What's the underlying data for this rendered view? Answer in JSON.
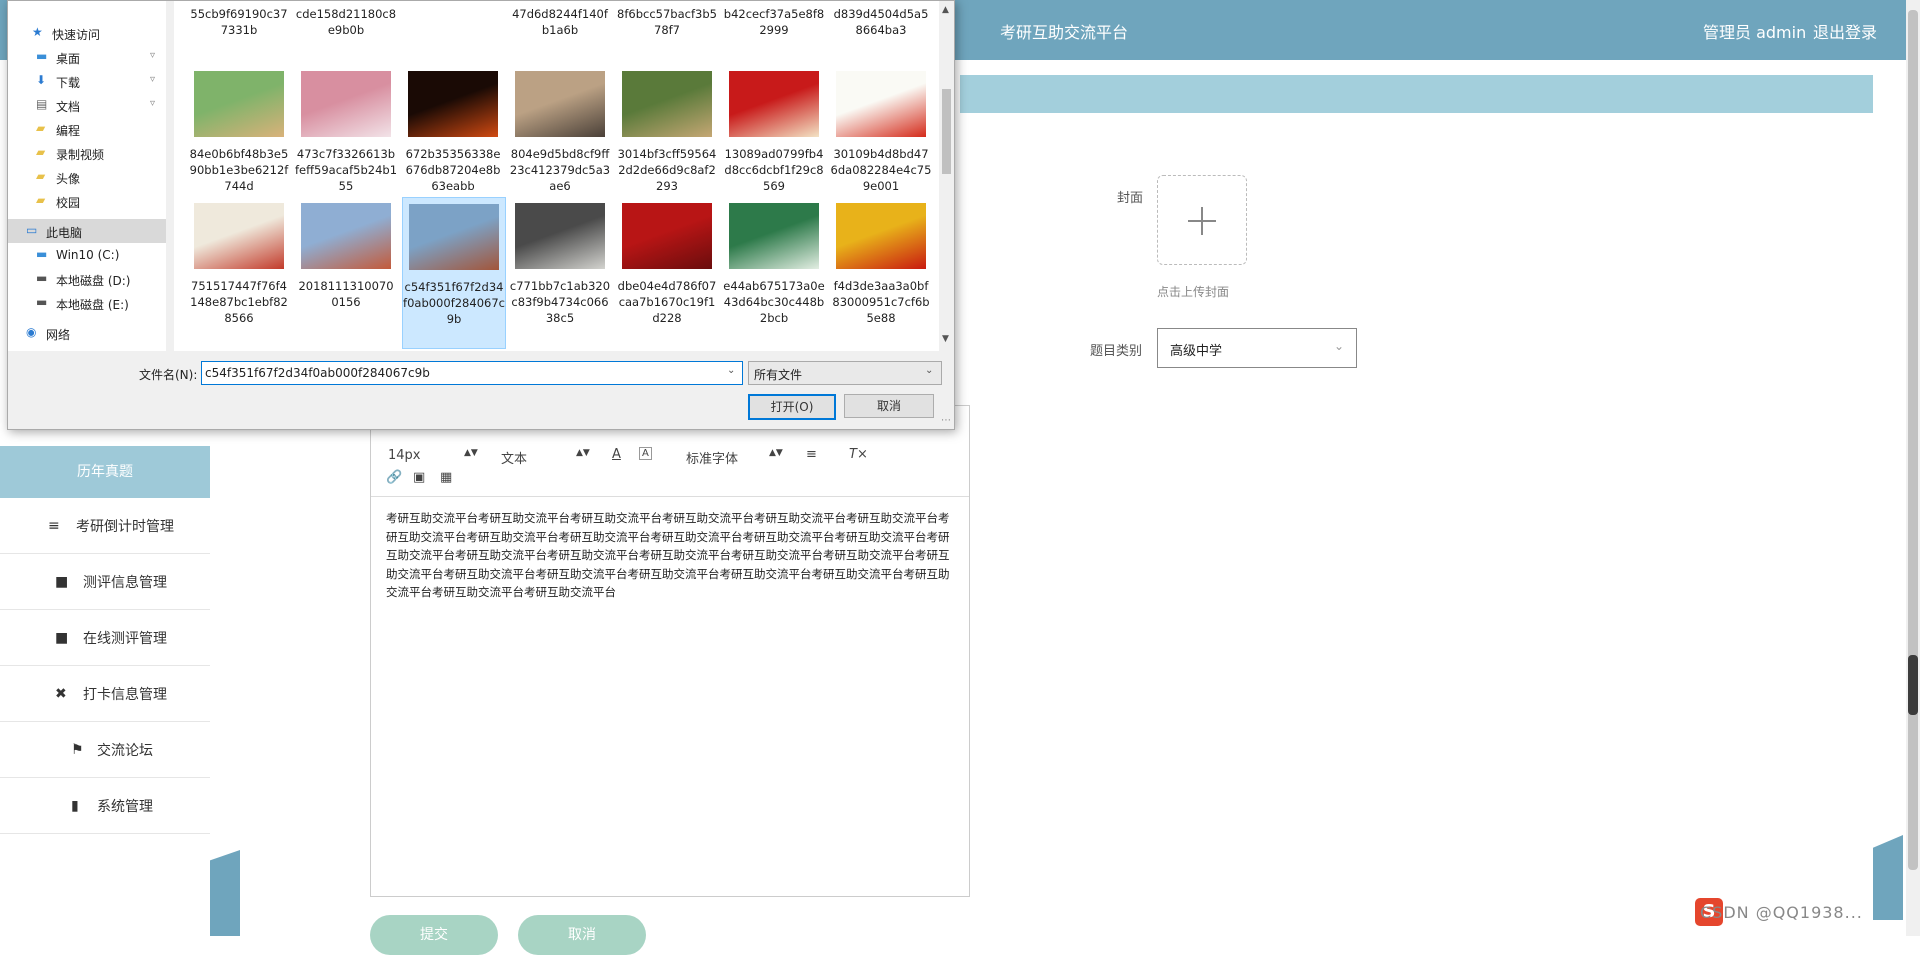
{
  "header": {
    "site_title": "考研互助交流平台",
    "admin_info": "管理员 admin",
    "logout": "退出登录"
  },
  "sidebar": {
    "active": "历年真题",
    "items": [
      {
        "label": "考研倒计时管理",
        "icon": "≡"
      },
      {
        "label": "测评信息管理",
        "icon": "■"
      },
      {
        "label": "在线测评管理",
        "icon": "■"
      },
      {
        "label": "打卡信息管理",
        "icon": "✖"
      },
      {
        "label": "交流论坛",
        "icon": "⚑"
      },
      {
        "label": "系统管理",
        "icon": "▮"
      }
    ]
  },
  "form": {
    "cover_label": "封面",
    "upload_tip": "点击上传封面",
    "category_label": "题目类别",
    "category_value": "高级中学"
  },
  "editor": {
    "font_size": "14px",
    "text_type": "文本",
    "font_family": "标准字体",
    "content": "考研互助交流平台考研互助交流平台考研互助交流平台考研互助交流平台考研互助交流平台考研互助交流平台考研互助交流平台考研互助交流平台考研互助交流平台考研互助交流平台考研互助交流平台考研互助交流平台考研互助交流平台考研互助交流平台考研互助交流平台考研互助交流平台考研互助交流平台考研互助交流平台考研互助交流平台考研互助交流平台考研互助交流平台考研互助交流平台考研互助交流平台考研互助交流平台考研互助交流平台考研互助交流平台考研互助交流平台"
  },
  "buttons": {
    "submit": "提交",
    "cancel": "取消"
  },
  "watermark": "CSDN @QQ1938...",
  "dialog": {
    "nav": [
      {
        "label": "快速访问",
        "icon": "★",
        "color": "#2b7bd1",
        "pinned": false
      },
      {
        "label": "桌面",
        "icon": "▬",
        "color": "#3a8fd8",
        "pinned": true
      },
      {
        "label": "下载",
        "icon": "⬇",
        "color": "#2b7bd1",
        "pinned": true
      },
      {
        "label": "文档",
        "icon": "▤",
        "color": "#666666",
        "pinned": true
      },
      {
        "label": "编程",
        "icon": "▰",
        "color": "#e8c14a",
        "pinned": false
      },
      {
        "label": "录制视频",
        "icon": "▰",
        "color": "#e8c14a",
        "pinned": false
      },
      {
        "label": "头像",
        "icon": "▰",
        "color": "#e8c14a",
        "pinned": false
      },
      {
        "label": "校园",
        "icon": "▰",
        "color": "#e8c14a",
        "pinned": false
      },
      {
        "label": "此电脑",
        "icon": "▭",
        "color": "#2b7bd1",
        "pinned": false
      },
      {
        "label": "Win10 (C:)",
        "icon": "▬",
        "color": "#3a8fd8",
        "pinned": false
      },
      {
        "label": "本地磁盘 (D:)",
        "icon": "▬",
        "color": "#555555",
        "pinned": false
      },
      {
        "label": "本地磁盘 (E:)",
        "icon": "▬",
        "color": "#555555",
        "pinned": false
      },
      {
        "label": "网络",
        "icon": "◉",
        "color": "#2b7bd1",
        "pinned": false
      }
    ],
    "top_partial": [
      "55cb9f69190c377331b",
      "cde158d21180c8e9b0b",
      "",
      "47d6d8244f140fb1a6b",
      "8f6bcc57bacf3b578f7",
      "b42cecf37a5e8f82999",
      "d839d4504d5a58664ba3"
    ],
    "row1": [
      {
        "name": "84e0b6bf48b3e590bb1e3be6212f744d",
        "colors": [
          "#7fb36a",
          "#d9b27a"
        ]
      },
      {
        "name": "473c7f3326613bfeff59acaf5b24b155",
        "colors": [
          "#d88fa0",
          "#f2e3e8"
        ]
      },
      {
        "name": "672b35356338e676db87204e8b63eabb",
        "colors": [
          "#1a0a05",
          "#d14a12"
        ]
      },
      {
        "name": "804e9d5bd8cf9ff23c412379dc5a3ae6",
        "colors": [
          "#bba184",
          "#4a4038"
        ]
      },
      {
        "name": "3014bf3cff595642d2de66d9c8af2293",
        "colors": [
          "#5a7a3a",
          "#c5a774"
        ]
      },
      {
        "name": "13089ad0799fb4d8cc6dcbf1f29c8569",
        "colors": [
          "#c81a1a",
          "#f3e3c5"
        ]
      },
      {
        "name": "30109b4d8bd476da082284e4c759e001",
        "colors": [
          "#fafaf5",
          "#d42a1a"
        ]
      }
    ],
    "row2": [
      {
        "name": "751517447f76f4148e87bc1ebf828566",
        "colors": [
          "#efe9dc",
          "#c23a2a"
        ]
      },
      {
        "name": "20181113100700156",
        "colors": [
          "#8faed3",
          "#c35a3a"
        ]
      },
      {
        "name": "c54f351f67f2d34f0ab000f284067c9b",
        "colors": [
          "#7ca2c6",
          "#a2553a"
        ],
        "selected": true
      },
      {
        "name": "c771bb7c1ab320c83f9b4734c06638c5",
        "colors": [
          "#4a4a4a",
          "#d3d3cf"
        ]
      },
      {
        "name": "dbe04e4d786f07caa7b1670c19f1d228",
        "colors": [
          "#b81515",
          "#6a0d0d"
        ]
      },
      {
        "name": "e44ab675173a0e43d64bc30c448b2bcb",
        "colors": [
          "#2d7a4a",
          "#e3eee3"
        ]
      },
      {
        "name": "f4d3de3aa3a0bf83000951c7cf6b5e88",
        "colors": [
          "#e8b21a",
          "#c81a10"
        ]
      }
    ],
    "filename_label": "文件名(N):",
    "filename_value": "c54f351f67f2d34f0ab000f284067c9b",
    "filetype": "所有文件",
    "open": "打开(O)",
    "cancel": "取消"
  }
}
